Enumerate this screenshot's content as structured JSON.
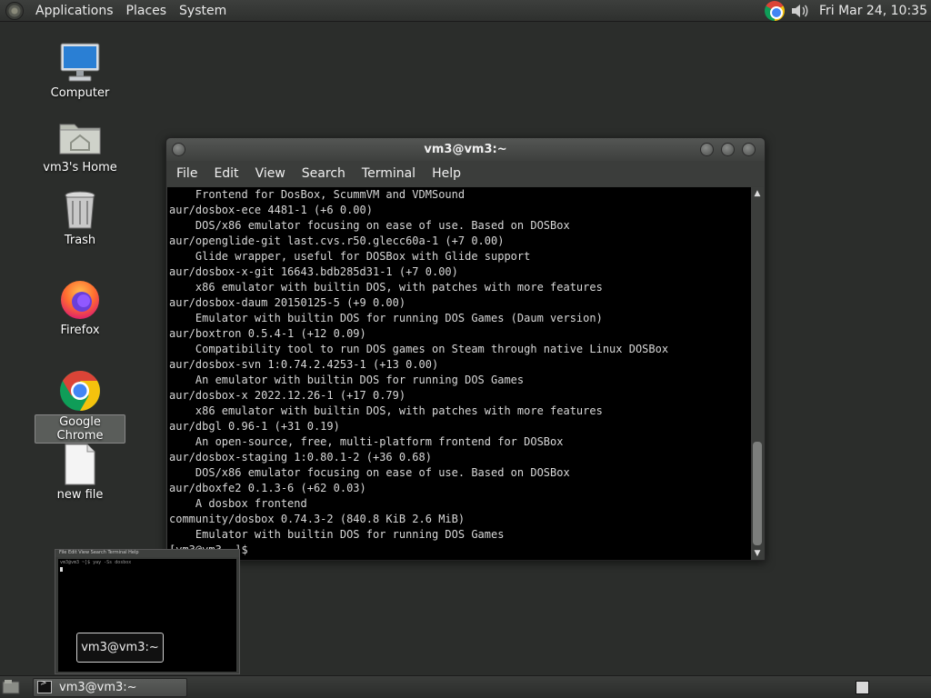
{
  "top_panel": {
    "menus": [
      "Applications",
      "Places",
      "System"
    ],
    "clock": "Fri Mar 24, 10:35"
  },
  "desktop": {
    "icons": [
      {
        "label": "Computer",
        "icon": "computer-icon"
      },
      {
        "label": "vm3's Home",
        "icon": "home-folder-icon"
      },
      {
        "label": "Trash",
        "icon": "trash-icon"
      },
      {
        "label": "Firefox",
        "icon": "firefox-icon"
      },
      {
        "label": "Google Chrome",
        "icon": "chrome-icon",
        "selected": true
      },
      {
        "label": "new file",
        "icon": "file-icon"
      }
    ]
  },
  "terminal": {
    "title": "vm3@vm3:~",
    "menu": [
      "File",
      "Edit",
      "View",
      "Search",
      "Terminal",
      "Help"
    ],
    "lines": [
      "    Frontend for DosBox, ScummVM and VDMSound",
      "aur/dosbox-ece 4481-1 (+6 0.00)",
      "    DOS/x86 emulator focusing on ease of use. Based on DOSBox",
      "aur/openglide-git last.cvs.r50.glecc60a-1 (+7 0.00)",
      "    Glide wrapper, useful for DOSBox with Glide support",
      "aur/dosbox-x-git 16643.bdb285d31-1 (+7 0.00)",
      "    x86 emulator with builtin DOS, with patches with more features",
      "aur/dosbox-daum 20150125-5 (+9 0.00)",
      "    Emulator with builtin DOS for running DOS Games (Daum version)",
      "aur/boxtron 0.5.4-1 (+12 0.09)",
      "    Compatibility tool to run DOS games on Steam through native Linux DOSBox",
      "aur/dosbox-svn 1:0.74.2.4253-1 (+13 0.00)",
      "    An emulator with builtin DOS for running DOS Games",
      "aur/dosbox-x 2022.12.26-1 (+17 0.79)",
      "    x86 emulator with builtin DOS, with patches with more features",
      "aur/dbgl 0.96-1 (+31 0.19)",
      "    An open-source, free, multi-platform frontend for DOSBox",
      "aur/dosbox-staging 1:0.80.1-2 (+36 0.68)",
      "    DOS/x86 emulator focusing on ease of use. Based on DOSBox",
      "aur/dboxfe2 0.1.3-6 (+62 0.03)",
      "    A dosbox frontend",
      "community/dosbox 0.74.3-2 (840.8 KiB 2.6 MiB)",
      "    Emulator with builtin DOS for running DOS Games",
      "[vm3@vm3 ~]$"
    ]
  },
  "preview": {
    "menu_text": "File  Edit  View  Search  Terminal  Help",
    "first_line": "vm3@vm3 ~]$ yay -Ss dosbox",
    "tooltip": "vm3@vm3:~"
  },
  "taskbar": {
    "task_label": "vm3@vm3:~"
  }
}
